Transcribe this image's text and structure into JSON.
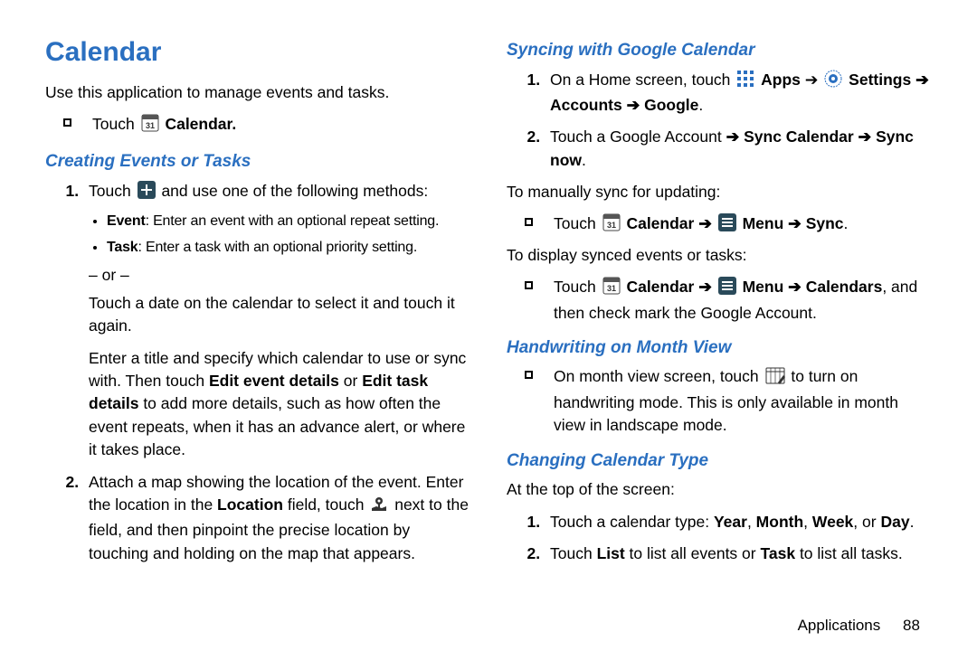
{
  "title": "Calendar",
  "intro": "Use this application to manage events and tasks.",
  "touch_label": "Touch",
  "calendar_label": "Calendar",
  "calendar_label_dot": "Calendar.",
  "section_creating": "Creating Events or Tasks",
  "creating_li1_a": "Touch",
  "creating_li1_b": "and use one of the following methods:",
  "creating_event_label": "Event",
  "creating_event_text": ": Enter an event with an optional repeat setting.",
  "creating_task_label": "Task",
  "creating_task_text": ": Enter a task with an optional priority setting.",
  "or_text": "– or –",
  "creating_or_para": "Touch a date on the calendar to select it and touch it again.",
  "creating_para2_a": "Enter a title and specify which calendar to use or sync with. Then touch ",
  "creating_para2_b1": "Edit event details",
  "creating_para2_mid": " or ",
  "creating_para2_b2": "Edit task details",
  "creating_para2_c": " to add more details, such as how often the event repeats, when it has an advance alert, or where it takes place.",
  "creating_li2_a": "Attach a map showing the location of the event. Enter the location in the ",
  "creating_li2_loc": "Location",
  "creating_li2_b": " field, touch ",
  "creating_li2_c": " next to the field, and then pinpoint the precise location by touching and holding on the map that appears.",
  "section_syncing": "Syncing with Google Calendar",
  "sync_li1_a": "On a Home screen, touch ",
  "sync_apps": "Apps",
  "arrow": " ➔ ",
  "sync_settings": "Settings",
  "sync_accounts": "Accounts",
  "sync_google_dot": "Google",
  "sync_li2_a": "Touch a Google Account ",
  "sync_sync_calendar": "Sync Calendar",
  "sync_sync_now": "Sync now",
  "sync_manual": "To manually sync for updating:",
  "sync_touch_a": "Touch",
  "menu_label": "Menu",
  "sync_label": "Sync",
  "calendars_label": "Calendars",
  "sync_display": "To display synced events or tasks:",
  "sync_display_tail": ", and then check mark the Google Account.",
  "section_handwriting": "Handwriting on Month View",
  "hand_a": "On month view screen, touch ",
  "hand_b": " to turn on handwriting mode. This is only available in month view in landscape mode.",
  "section_changing": "Changing Calendar Type",
  "changing_intro": "At the top of the screen:",
  "changing_li1_a": "Touch a calendar type: ",
  "y": "Year",
  "m": "Month",
  "w": "Week",
  "d": "Day",
  "comma": ", ",
  "or_word": ", or ",
  "dot": ".",
  "changing_li2_a": "Touch ",
  "list_label": "List",
  "changing_li2_b": " to list all events or ",
  "task_label": "Task",
  "changing_li2_c": " to list all tasks.",
  "footer_section": "Applications",
  "footer_page": "88"
}
